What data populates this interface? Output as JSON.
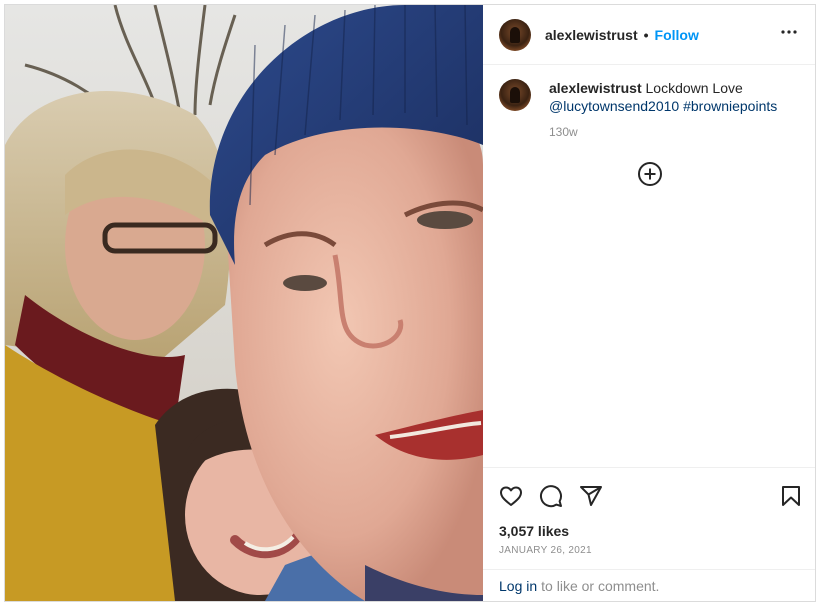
{
  "post": {
    "username": "alexlewistrust",
    "separator": "•",
    "follow_label": "Follow",
    "more_label": "•••",
    "caption": {
      "username": "alexlewistrust",
      "text": "Lockdown Love",
      "mention": "@lucytownsend2010",
      "hashtag": "#browniepoints",
      "time": "130w"
    },
    "likes": "3,057 likes",
    "date": "JANUARY 26, 2021",
    "login": {
      "link": "Log in",
      "rest": "to like or comment."
    }
  },
  "icons": {
    "more": "more-options-icon",
    "load_more": "plus-circle-icon",
    "like": "heart-icon",
    "comment": "comment-icon",
    "share": "paper-plane-icon",
    "save": "bookmark-icon"
  },
  "colors": {
    "follow": "#0095f6",
    "link": "#00376b",
    "muted": "#8e8e8e",
    "border": "#dbdbdb"
  }
}
